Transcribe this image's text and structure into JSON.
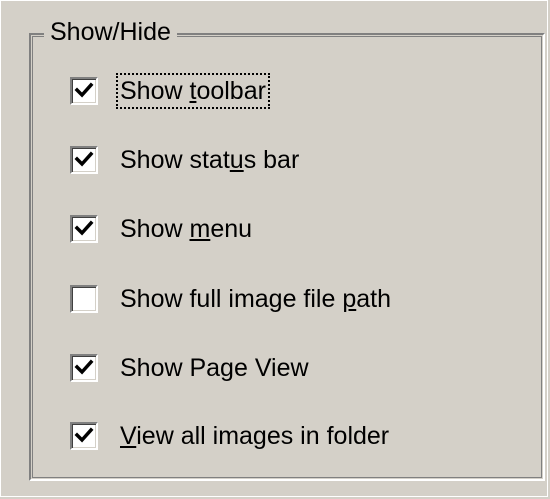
{
  "groupbox": {
    "title": "Show/Hide"
  },
  "options": [
    {
      "pre": "Show ",
      "accel": "t",
      "post": "oolbar",
      "checked": true,
      "focused": true
    },
    {
      "pre": "Show stat",
      "accel": "u",
      "post": "s bar",
      "checked": true,
      "focused": false
    },
    {
      "pre": "Show ",
      "accel": "m",
      "post": "enu",
      "checked": true,
      "focused": false
    },
    {
      "pre": "Show full image file ",
      "accel": "p",
      "post": "ath",
      "checked": false,
      "focused": false
    },
    {
      "pre": "Show Page View",
      "accel": "",
      "post": "",
      "checked": true,
      "focused": false
    },
    {
      "pre": "",
      "accel": "V",
      "post": "iew all images in folder",
      "checked": true,
      "focused": false
    }
  ]
}
